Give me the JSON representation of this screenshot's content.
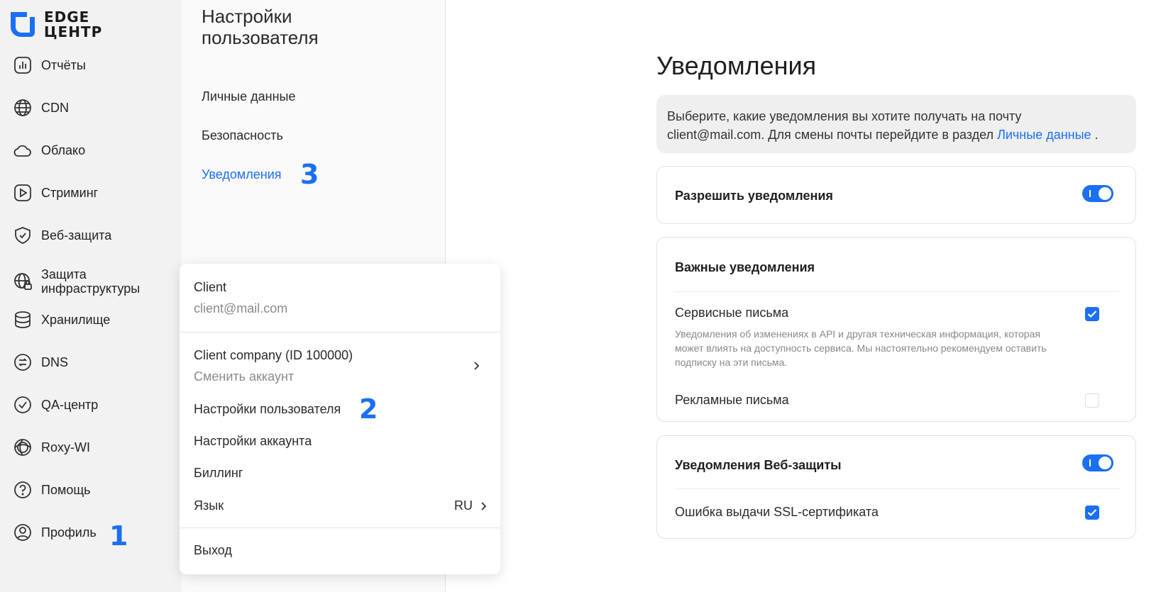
{
  "logo": {
    "line1": "EDGE",
    "line2": "ЦЕНТР",
    "icon": "edge-center-logo"
  },
  "sidebar": {
    "items": [
      {
        "label": "Отчёты",
        "icon": "reports-icon"
      },
      {
        "label": "CDN",
        "icon": "globe-icon"
      },
      {
        "label": "Облако",
        "icon": "cloud-icon"
      },
      {
        "label": "Стриминг",
        "icon": "play-icon"
      },
      {
        "label": "Веб-защита",
        "icon": "shield-icon"
      },
      {
        "label": "Защита\nинфраструктуры",
        "icon": "globe-lock-icon"
      },
      {
        "label": "Хранилище",
        "icon": "database-icon"
      },
      {
        "label": "DNS",
        "icon": "dns-icon"
      },
      {
        "label": "QA-центр",
        "icon": "check-circle-icon"
      },
      {
        "label": "Roxy-WI",
        "icon": "roxy-icon"
      },
      {
        "label": "Помощь",
        "icon": "help-icon"
      },
      {
        "label": "Профиль",
        "icon": "user-icon"
      }
    ]
  },
  "steps": {
    "one": "1",
    "two": "2",
    "three": "3"
  },
  "settings": {
    "title": "Настройки\nпользователя",
    "links": [
      "Личные данные",
      "Безопасность",
      "Уведомления"
    ]
  },
  "menu": {
    "user_name": "Client",
    "user_email": "client@mail.com",
    "company": "Client company (ID 100000)",
    "switch_account": "Сменить аккаунт",
    "user_settings": "Настройки пользователя",
    "account_settings": "Настройки аккаунта",
    "billing": "Биллинг",
    "language_label": "Язык",
    "language_value": "RU",
    "logout": "Выход"
  },
  "main": {
    "title": "Уведомления",
    "info_prefix": "Выберите, какие уведомления вы хотите получать на почту",
    "info_line2": "client@mail.com. Для смены почты перейдите в раздел",
    "info_link": "Личные данные",
    "info_suffix": " .",
    "allow_notifications": "Разрешить уведомления",
    "important_title": "Важные уведомления",
    "service_letters": "Сервисные письма",
    "service_desc": "Уведомления об изменениях в API и другая техническая информация, которая может влиять на доступность сервиса. Мы настоятельно рекомендуем оставить подписку на эти письма.",
    "promo_letters": "Рекламные письма",
    "waf_title": "Уведомления Веб-защиты",
    "ssl_error": "Ошибка выдачи SSL-сертификата"
  },
  "states": {
    "allow_notifications_on": true,
    "service_checked": true,
    "promo_checked": false,
    "waf_on": true,
    "ssl_checked": true
  },
  "colors": {
    "accent": "#1a6ff2",
    "sidebar_bg": "#f2f2f2",
    "info_bg": "#efefef"
  }
}
